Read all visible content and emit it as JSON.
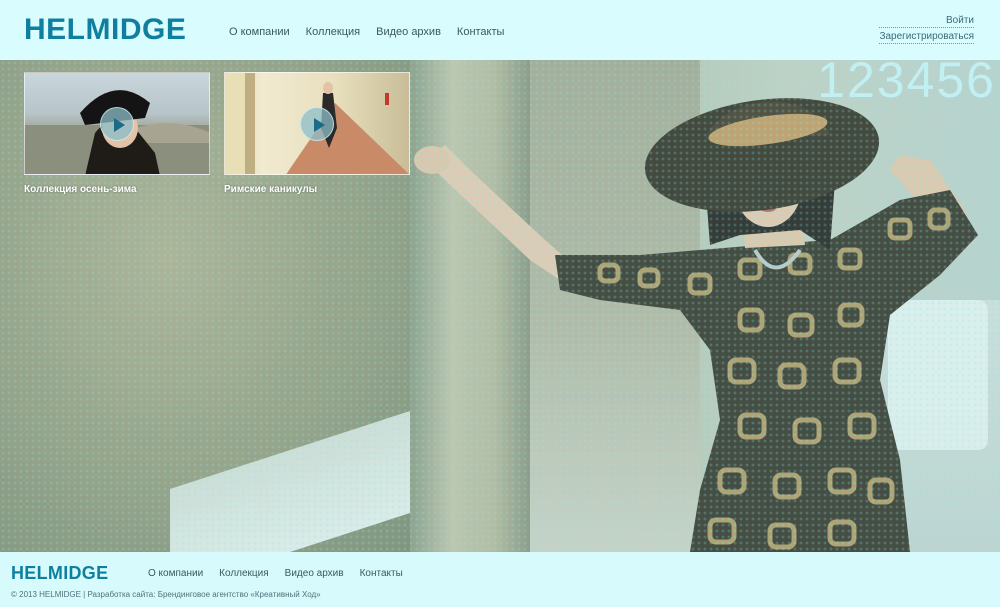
{
  "header": {
    "logo": "HELMIDGE",
    "nav": [
      "О компании",
      "Коллекция",
      "Видео архив",
      "Контакты"
    ],
    "auth": {
      "login": "Войти",
      "register": "Зарегистрироваться"
    }
  },
  "hero": {
    "counter": "123456"
  },
  "videos": [
    {
      "title": "Коллекция осень-зима"
    },
    {
      "title": "Римские каникулы"
    }
  ],
  "footer": {
    "logo": "HELMIDGE",
    "nav": [
      "О компании",
      "Коллекция",
      "Видео архив",
      "Контакты"
    ],
    "copyright": "© 2013 HELMIDGE | Разработка сайта: Брендинговое агентство «Креативный Ход»"
  },
  "colors": {
    "brand": "#0f7fa0",
    "background": "#d7fbfd",
    "nav_text": "#3b5860"
  },
  "icons": {
    "play": "play-icon"
  }
}
